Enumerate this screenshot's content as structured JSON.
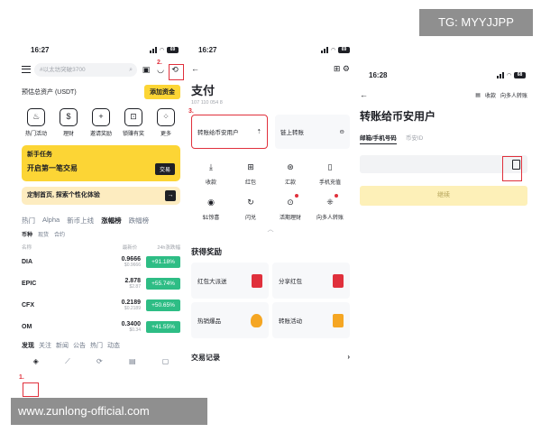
{
  "watermark_top": "TG: MYYJJPP",
  "watermark_bottom": "www.zunlong-official.com",
  "screen1": {
    "time": "16:27",
    "battery": "69",
    "search_placeholder": "#以太坊突破3700",
    "step2": "2.",
    "step1": "1.",
    "assets_label": "预估总资产 (USDT)",
    "add_funds": "添加资金",
    "quick": [
      {
        "label": "热门活动",
        "icon": "fire-icon"
      },
      {
        "label": "理财",
        "icon": "coin-bag-icon"
      },
      {
        "label": "邀请奖励",
        "icon": "person-plus-icon"
      },
      {
        "label": "锁赚有奖",
        "icon": "lock-icon"
      },
      {
        "label": "更多",
        "icon": "grid-icon"
      }
    ],
    "task_title": "新手任务",
    "task_text": "开启第一笔交易",
    "task_button": "交易",
    "custom_text": "定制首页, 探索个性化体验",
    "market_tabs": [
      "热门",
      "Alpha",
      "新币上线",
      "涨幅榜",
      "跌幅榜"
    ],
    "market_tab_active": 3,
    "sub_tabs": [
      "币种",
      "现货",
      "合约"
    ],
    "col_name": "名称",
    "col_price": "最新价",
    "col_change": "24h涨跌幅",
    "rows": [
      {
        "name": "DIA",
        "price": "0.9666",
        "sub": "$0.9666",
        "change": "+91.18%"
      },
      {
        "name": "EPIC",
        "price": "2.878",
        "sub": "$2.87",
        "change": "+55.74%"
      },
      {
        "name": "CFX",
        "price": "0.2189",
        "sub": "$0.2189",
        "change": "+50.65%"
      },
      {
        "name": "OM",
        "price": "0.3400",
        "sub": "$0.34",
        "change": "+41.55%"
      }
    ],
    "news_tabs": [
      "发现",
      "关注",
      "新闻",
      "公告",
      "热门",
      "动态"
    ]
  },
  "screen2": {
    "time": "16:27",
    "battery": "69",
    "title": "支付",
    "uid": "107 110 054 8",
    "step3": "3.",
    "transfer_user": "转账给币安用户",
    "chain_transfer": "链上转账",
    "grid": [
      {
        "label": "收款",
        "icon": "download-icon"
      },
      {
        "label": "红包",
        "icon": "gift-icon"
      },
      {
        "label": "汇款",
        "icon": "remit-icon"
      },
      {
        "label": "手机充值",
        "icon": "phone-icon"
      },
      {
        "label": "$1惊喜",
        "icon": "surprise-icon"
      },
      {
        "label": "闪兑",
        "icon": "swap-icon"
      },
      {
        "label": "活期理财",
        "icon": "savings-icon"
      },
      {
        "label": "向多人转账",
        "icon": "multi-transfer-icon"
      }
    ],
    "rewards_title": "获得奖励",
    "rewards": [
      {
        "label": "红包大派送",
        "icon": "red-envelope-icon"
      },
      {
        "label": "分享红包",
        "icon": "red-envelope-icon"
      },
      {
        "label": "热销爆品",
        "icon": "flame-icon"
      },
      {
        "label": "转账活动",
        "icon": "red-envelope-icon"
      }
    ],
    "transactions": "交易记录"
  },
  "screen3": {
    "time": "16:28",
    "battery": "68",
    "receive": "收款",
    "multi": "向多人转账",
    "title": "转账给币安用户",
    "tab_email": "邮箱/手机号码",
    "tab_id": "币安ID",
    "step4": "4.",
    "continue": "继续"
  }
}
